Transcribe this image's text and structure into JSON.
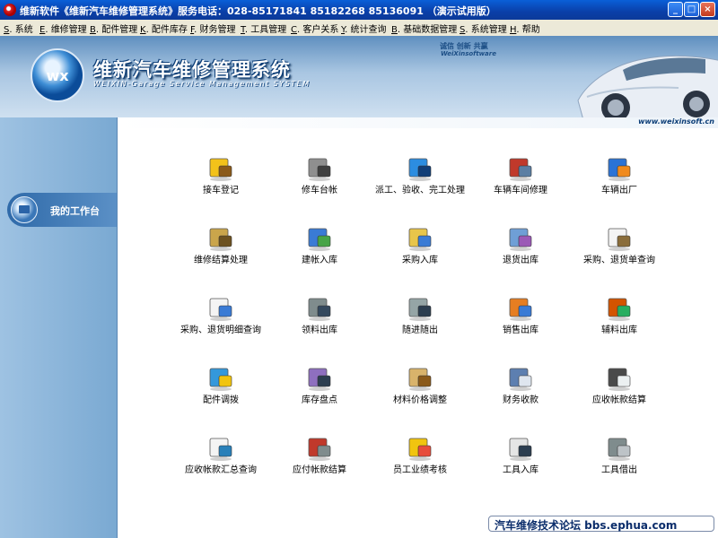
{
  "window": {
    "title": "维新软件《维新汽车维修管理系统》服务电话：028-85171841  85182268  85136091 （演示试用版）",
    "controls": [
      "_",
      "□",
      "×"
    ]
  },
  "menu": [
    {
      "key": "S",
      "label": "系统"
    },
    {
      "key": "E",
      "label": "维修管理"
    },
    {
      "key": "B",
      "label": "配件管理"
    },
    {
      "key": "K",
      "label": "配件库存"
    },
    {
      "key": "F",
      "label": "财务管理"
    },
    {
      "key": "T",
      "label": "工具管理"
    },
    {
      "key": "C",
      "label": "客户关系"
    },
    {
      "key": "Y",
      "label": "统计查询"
    },
    {
      "key": "B",
      "label": "基础数据管理"
    },
    {
      "key": "S",
      "label": "系统管理"
    },
    {
      "key": "H",
      "label": "帮助"
    }
  ],
  "banner": {
    "title": "维新汽车维修管理系统",
    "subtitle": "WEIXIN-Garage Service Management SYSTEM",
    "motto": "诚信 创新 共赢",
    "brand": "WeiXinsoftware",
    "url": "www.weixinsoft.cn",
    "logo_mark": "wx"
  },
  "sidebar": {
    "items": [
      {
        "label": "我的工作台"
      }
    ]
  },
  "functions": [
    {
      "label": "接车登记",
      "icon": "car-reception-icon"
    },
    {
      "label": "修车台帐",
      "icon": "repair-ledger-icon"
    },
    {
      "label": "派工、验收、完工处理",
      "icon": "dispatch-worker-icon"
    },
    {
      "label": "车辆车间修理",
      "icon": "workshop-repair-icon"
    },
    {
      "label": "车辆出厂",
      "icon": "vehicle-exit-icon"
    },
    {
      "label": "维修结算处理",
      "icon": "repair-settlement-icon"
    },
    {
      "label": "建帐入库",
      "icon": "account-stock-in-icon"
    },
    {
      "label": "采购入库",
      "icon": "purchase-stock-in-icon"
    },
    {
      "label": "退货出库",
      "icon": "return-stock-out-icon"
    },
    {
      "label": "采购、退货单查询",
      "icon": "order-query-icon"
    },
    {
      "label": "采购、退货明细查询",
      "icon": "detail-query-icon"
    },
    {
      "label": "领料出库",
      "icon": "material-requisition-icon"
    },
    {
      "label": "随进随出",
      "icon": "in-out-icon"
    },
    {
      "label": "销售出库",
      "icon": "sales-stock-out-icon"
    },
    {
      "label": "辅料出库",
      "icon": "auxiliary-stock-out-icon"
    },
    {
      "label": "配件调拨",
      "icon": "parts-transfer-icon"
    },
    {
      "label": "库存盘点",
      "icon": "inventory-check-icon"
    },
    {
      "label": "材料价格调整",
      "icon": "price-adjust-icon"
    },
    {
      "label": "财务收款",
      "icon": "finance-receipt-icon"
    },
    {
      "label": "应收帐款结算",
      "icon": "receivable-settlement-icon"
    },
    {
      "label": "应收帐款汇总查询",
      "icon": "receivable-summary-icon"
    },
    {
      "label": "应付帐款结算",
      "icon": "payable-settlement-icon"
    },
    {
      "label": "员工业绩考核",
      "icon": "performance-review-icon"
    },
    {
      "label": "工具入库",
      "icon": "tool-stock-in-icon"
    },
    {
      "label": "工具借出",
      "icon": "tool-lending-icon"
    }
  ],
  "watermark": "汽车维修技术论坛 bbs.ephua.com"
}
